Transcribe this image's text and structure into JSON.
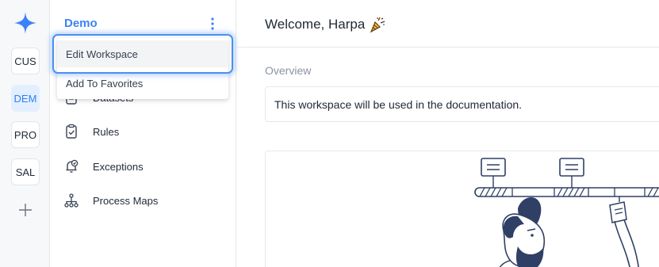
{
  "workspaces": [
    "CUS",
    "DEM",
    "PRO",
    "SAL"
  ],
  "active_workspace_index": 1,
  "sidebar": {
    "title": "Demo",
    "items": [
      {
        "label": "Datasets",
        "icon": "clipboard-list-icon"
      },
      {
        "label": "Rules",
        "icon": "clipboard-check-icon"
      },
      {
        "label": "Exceptions",
        "icon": "bell-check-icon"
      },
      {
        "label": "Process Maps",
        "icon": "process-tree-icon"
      }
    ]
  },
  "menu": {
    "items": [
      "Edit Workspace",
      "Add To Favorites"
    ]
  },
  "header": {
    "welcome": "Welcome, Harpa"
  },
  "overview": {
    "label": "Overview",
    "description": "This workspace will be used in the documentation."
  },
  "colors": {
    "accent": "#3b82f6",
    "active_workspace_bg": "#e3efff",
    "illustration_dark": "#2f3f66"
  }
}
